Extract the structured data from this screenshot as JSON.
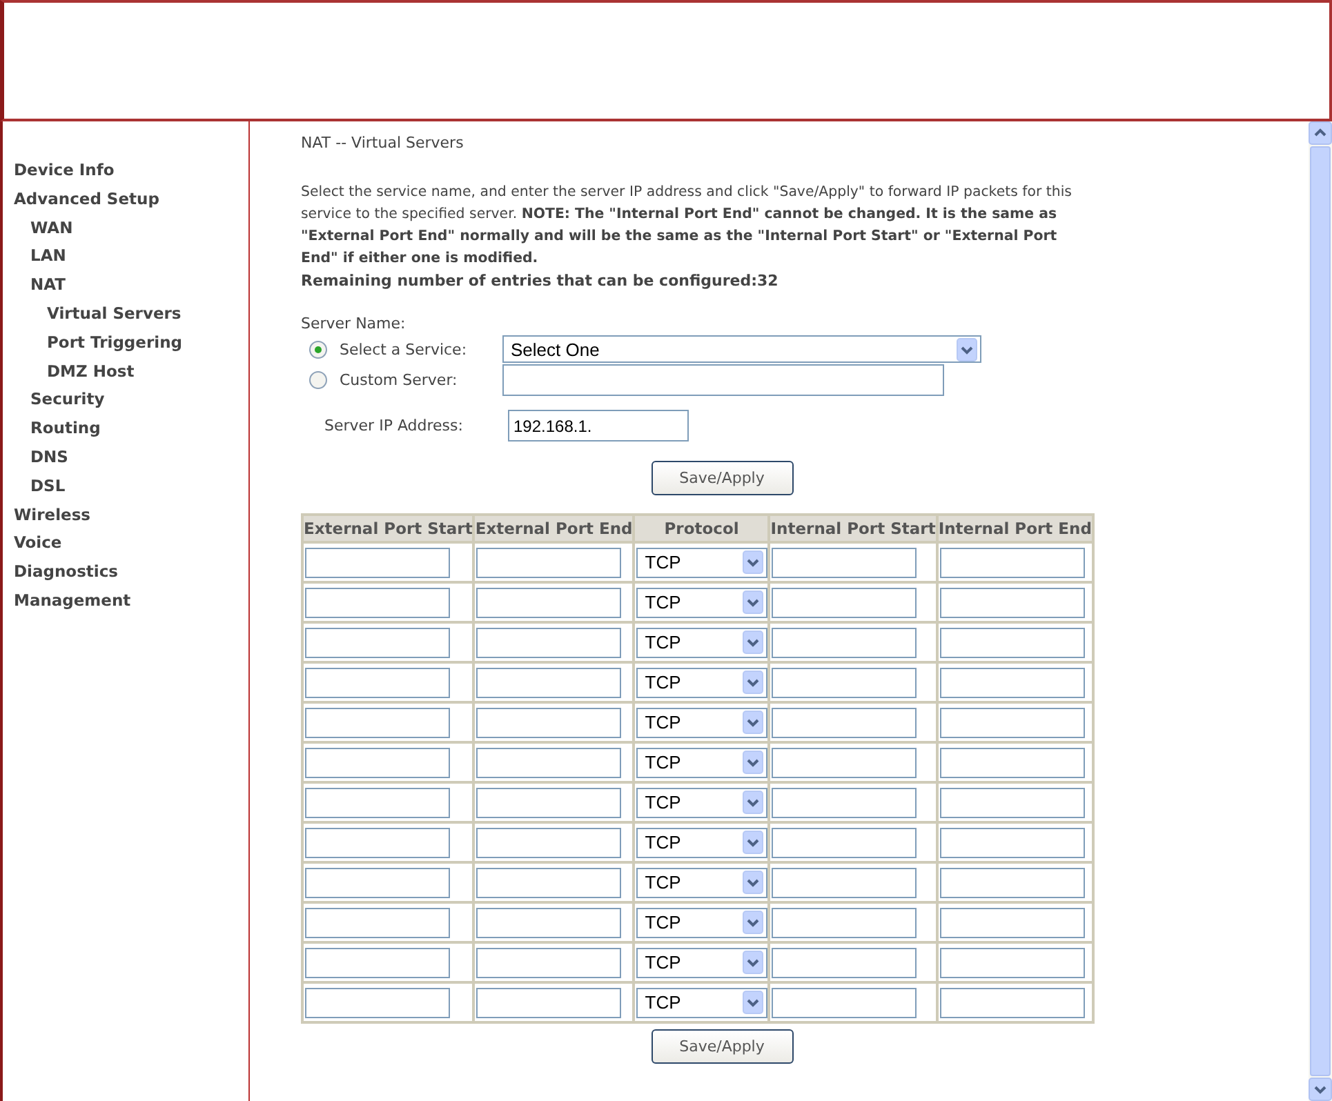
{
  "sidebar": {
    "items": [
      {
        "label": "Device Info"
      },
      {
        "label": "Advanced Setup",
        "children": [
          {
            "label": "WAN"
          },
          {
            "label": "LAN"
          },
          {
            "label": "NAT",
            "children": [
              {
                "label": "Virtual Servers"
              },
              {
                "label": "Port Triggering"
              },
              {
                "label": "DMZ Host"
              }
            ]
          },
          {
            "label": "Security"
          },
          {
            "label": "Routing"
          },
          {
            "label": "DNS"
          },
          {
            "label": "DSL"
          }
        ]
      },
      {
        "label": "Wireless"
      },
      {
        "label": "Voice"
      },
      {
        "label": "Diagnostics"
      },
      {
        "label": "Management"
      }
    ]
  },
  "page": {
    "title": "NAT -- Virtual Servers",
    "intro": "Select the service name, and enter the server IP address and click \"Save/Apply\" to forward IP packets for this service to the specified server. **NOTE: The \"Internal Port End\" cannot be changed. It is the same as \"External Port End\" normally and will be the same as the \"Internal Port Start\" or \"External Port End\" if either one is modified.**",
    "remaining": "Remaining number of entries that can be configured:32",
    "server_name_label": "Server Name:",
    "server_options": [
      {
        "label": "Select a Service:",
        "selected": true,
        "kind": "select",
        "value": "Select One"
      },
      {
        "label": "Custom Server:",
        "selected": false,
        "kind": "text"
      }
    ],
    "server_ip": {
      "label": "Server IP Address:",
      "value": "192.168.1."
    },
    "save_button_top": "Save/Apply",
    "table": {
      "columns": [
        "External Port Start",
        "External Port End",
        "Protocol",
        "Internal Port Start",
        "Internal Port End"
      ],
      "rows": [
        {
          "protocol": "TCP"
        },
        {
          "protocol": "TCP"
        },
        {
          "protocol": "TCP"
        },
        {
          "protocol": "TCP"
        },
        {
          "protocol": "TCP"
        },
        {
          "protocol": "TCP"
        },
        {
          "protocol": "TCP"
        },
        {
          "protocol": "TCP"
        },
        {
          "protocol": "TCP"
        },
        {
          "protocol": "TCP"
        },
        {
          "protocol": "TCP"
        },
        {
          "protocol": "TCP"
        }
      ]
    },
    "save_button_bottom": "Save/Apply"
  }
}
